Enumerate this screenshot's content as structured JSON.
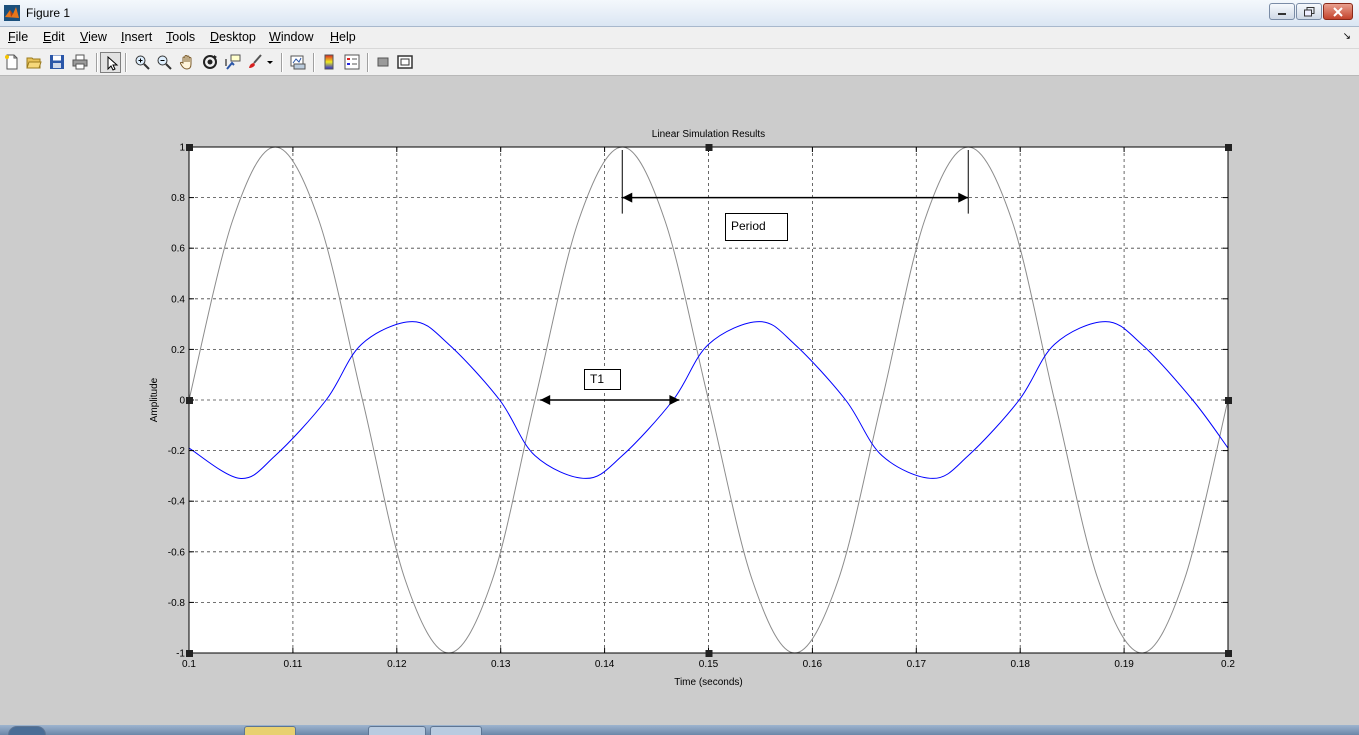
{
  "window": {
    "title": "Figure 1"
  },
  "menu": [
    {
      "label": "File",
      "ul": "F",
      "rest": "ile"
    },
    {
      "label": "Edit",
      "ul": "E",
      "rest": "dit"
    },
    {
      "label": "View",
      "ul": "V",
      "rest": "iew"
    },
    {
      "label": "Insert",
      "ul": "I",
      "rest": "nsert"
    },
    {
      "label": "Tools",
      "ul": "T",
      "rest": "ools"
    },
    {
      "label": "Desktop",
      "ul": "D",
      "rest": "esktop"
    },
    {
      "label": "Window",
      "ul": "W",
      "rest": "indow"
    },
    {
      "label": "Help",
      "ul": "H",
      "rest": "elp"
    }
  ],
  "toolbar": {
    "buttons": [
      "new-figure",
      "open-file",
      "save-figure",
      "print-figure",
      "edit-plot",
      "zoom-in",
      "zoom-out",
      "pan",
      "rotate-3d",
      "data-cursor",
      "brush",
      "link-plot",
      "colorbar",
      "legend",
      "hide-plot-tools",
      "show-plot-tools"
    ],
    "pressed": "edit-plot"
  },
  "chart_data": {
    "type": "line",
    "title": "Linear Simulation Results",
    "xlabel": "Time (seconds)",
    "ylabel": "Amplitude",
    "xlim": [
      0.1,
      0.2
    ],
    "ylim": [
      -1,
      1
    ],
    "xticks": [
      0.1,
      0.11,
      0.12,
      0.13,
      0.14,
      0.15,
      0.16,
      0.17,
      0.18,
      0.19,
      0.2
    ],
    "xtick_labels": [
      "0.1",
      "0.11",
      "0.12",
      "0.13",
      "0.14",
      "0.15",
      "0.16",
      "0.17",
      "0.18",
      "0.19",
      "0.2"
    ],
    "yticks": [
      -1,
      -0.8,
      -0.6,
      -0.4,
      -0.2,
      0,
      0.2,
      0.4,
      0.6,
      0.8,
      1
    ],
    "ytick_labels": [
      "-1",
      "-0.8",
      "-0.6",
      "-0.4",
      "-0.2",
      "0",
      "0.2",
      "0.4",
      "0.6",
      "0.8",
      "1"
    ],
    "grid": true,
    "series": [
      {
        "color": "#8c8c8c",
        "x": [
          0.1,
          0.1042,
          0.1083,
          0.1125,
          0.1167,
          0.1208,
          0.125,
          0.1292,
          0.1333,
          0.1375,
          0.1417,
          0.1458,
          0.15,
          0.1542,
          0.1583,
          0.1625,
          0.1667,
          0.1708,
          0.175,
          0.1792,
          0.1833,
          0.1875,
          0.1917,
          0.1958,
          0.2
        ],
        "y": [
          0,
          0.71,
          1,
          0.71,
          0,
          -0.71,
          -1,
          -0.71,
          0,
          0.71,
          1,
          0.71,
          0,
          -0.71,
          -1,
          -0.71,
          0,
          0.71,
          1,
          0.71,
          0,
          -0.71,
          -1,
          -0.71,
          0
        ]
      },
      {
        "color": "#0000ff",
        "x": [
          0.1,
          0.1049,
          0.1083,
          0.1132,
          0.1166,
          0.1215,
          0.125,
          0.1299,
          0.1333,
          0.1382,
          0.1417,
          0.1466,
          0.15,
          0.1549,
          0.1583,
          0.1632,
          0.1667,
          0.1716,
          0.175,
          0.1799,
          0.1833,
          0.1882,
          0.1917,
          0.1966,
          0.2
        ],
        "y": [
          -0.19,
          -0.31,
          -0.22,
          0,
          0.22,
          0.31,
          0.22,
          0,
          -0.22,
          -0.31,
          -0.22,
          0,
          0.22,
          0.31,
          0.22,
          0,
          -0.22,
          -0.31,
          -0.22,
          0,
          0.22,
          0.31,
          0.22,
          0,
          -0.19
        ]
      }
    ],
    "annotations": [
      {
        "text": "Period",
        "arrow": {
          "x1": 0.1417,
          "x2": 0.175,
          "y": 0.8
        }
      },
      {
        "text": "T1",
        "arrow": {
          "x1": 0.1338,
          "x2": 0.1472,
          "y": 0
        }
      }
    ]
  }
}
